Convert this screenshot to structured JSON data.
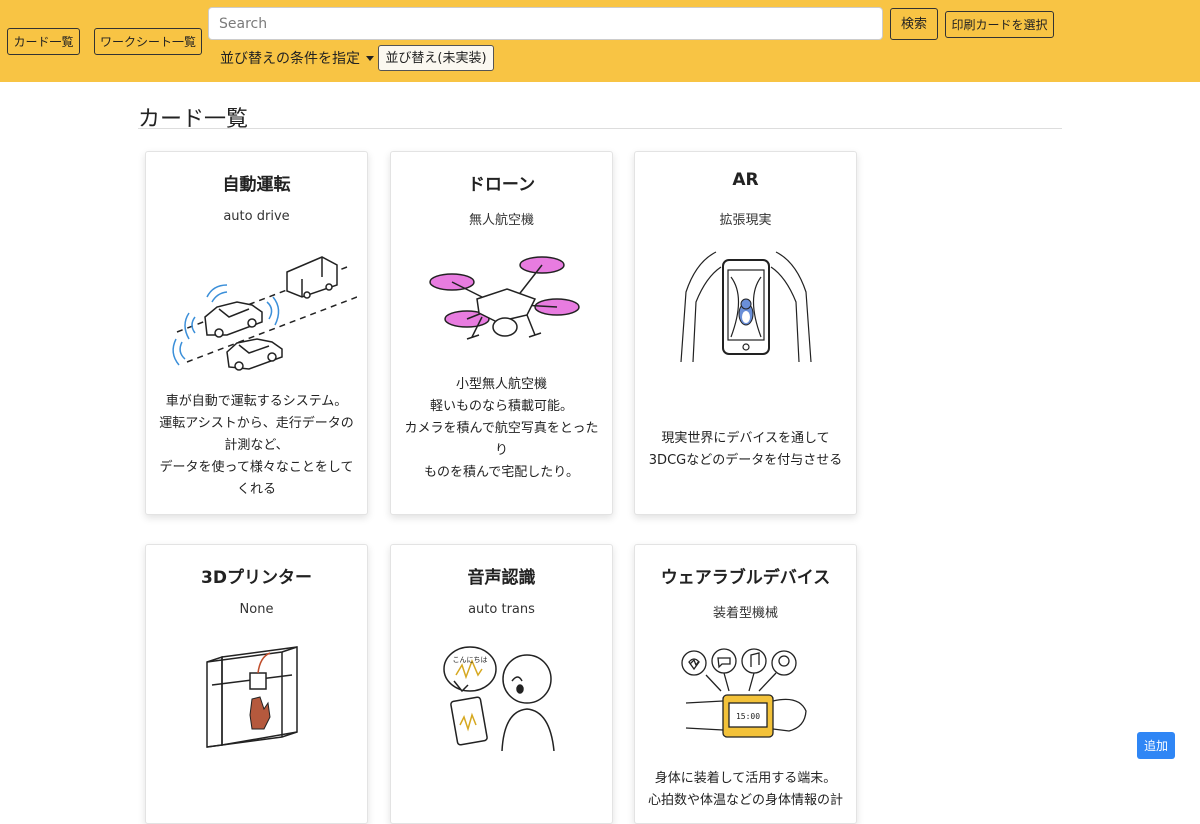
{
  "topbar": {
    "card_list_button": "カード一覧",
    "worksheet_list_button": "ワークシート一覧",
    "search_placeholder": "Search",
    "search_button": "検索",
    "print_select_button": "印刷カードを選択",
    "sort_condition_label": "並び替えの条件を指定",
    "sort_button": "並び替え(未実装)",
    "bar_color": "#f8c444"
  },
  "page": {
    "heading": "カード一覧"
  },
  "cards": [
    {
      "title": "自動運転",
      "subtitle": "auto drive",
      "image_icon": "self-driving-cars-illustration",
      "description": "車が自動で運転するシステム。\n運転アシストから、走行データの\n計測など、\nデータを使って様々なことをして\nくれる"
    },
    {
      "title": "ドローン",
      "subtitle": "無人航空機",
      "image_icon": "drone-illustration",
      "description": "小型無人航空機\n軽いものなら積載可能。\nカメラを積んで航空写真をとった\nり\nものを積んで宅配したり。"
    },
    {
      "title": "AR",
      "subtitle": "拡張現実",
      "image_icon": "smartphone-ar-illustration",
      "description": "現実世界にデバイスを通して\n3DCGなどのデータを付与させる"
    },
    {
      "title": "3Dプリンター",
      "subtitle": "None",
      "image_icon": "3d-printer-illustration",
      "description": ""
    },
    {
      "title": "音声認識",
      "subtitle": "auto trans",
      "image_icon": "voice-recognition-illustration",
      "speech_bubble_text": "こんにちは",
      "description": ""
    },
    {
      "title": "ウェアラブルデバイス",
      "subtitle": "装着型機械",
      "image_icon": "smartwatch-illustration",
      "watch_time": "15:00",
      "description": "身体に装着して活用する端末。\n心拍数や体温などの身体情報の計"
    }
  ],
  "add_button": "追加",
  "colors": {
    "accent_blue": "#2f86f5",
    "drone_pink": "#e87ce0",
    "watch_yellow": "#f3c23a"
  }
}
